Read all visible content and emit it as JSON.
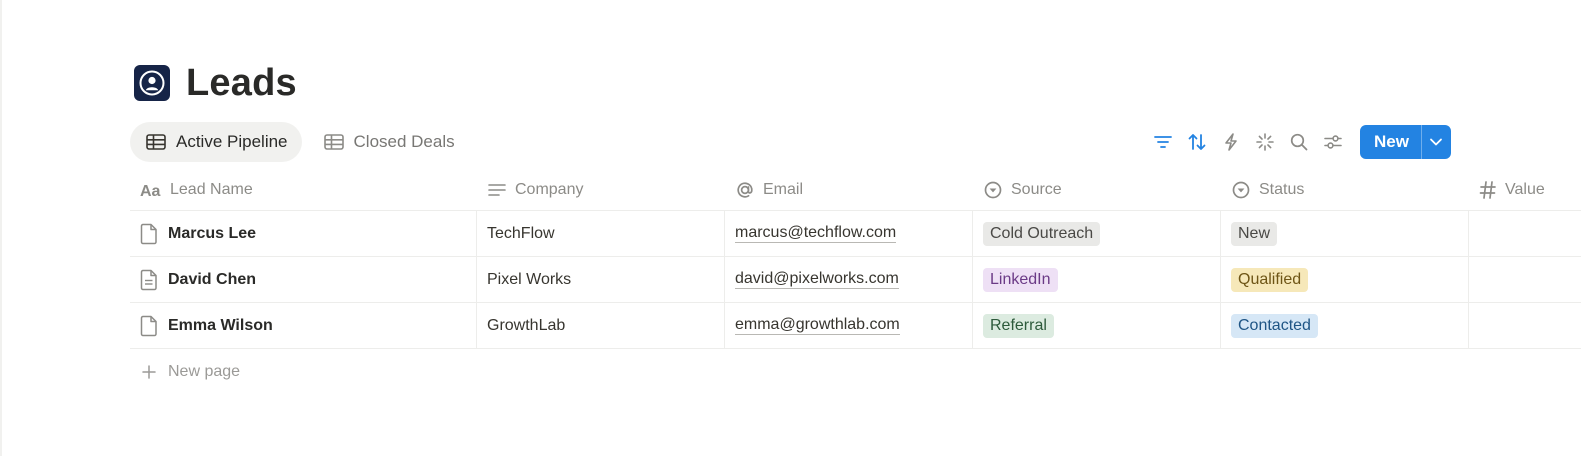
{
  "page": {
    "title": "Leads"
  },
  "views": [
    {
      "label": "Active Pipeline",
      "active": true
    },
    {
      "label": "Closed Deals",
      "active": false
    }
  ],
  "toolbar": {
    "new_label": "New",
    "accent": "#2383e2"
  },
  "table": {
    "columns": [
      {
        "label": "Lead Name",
        "icon": "title-aa-icon"
      },
      {
        "label": "Company",
        "icon": "text-lines-icon"
      },
      {
        "label": "Email",
        "icon": "at-sign-icon"
      },
      {
        "label": "Source",
        "icon": "select-circle-icon"
      },
      {
        "label": "Status",
        "icon": "select-circle-icon"
      },
      {
        "label": "Value",
        "icon": "number-hash-icon"
      }
    ],
    "rows": [
      {
        "name": "Marcus Lee",
        "company": "TechFlow",
        "email": "marcus@techflow.com",
        "source": {
          "label": "Cold Outreach",
          "bg": "#e9e9e7",
          "fg": "#4a4946"
        },
        "status": {
          "label": "New",
          "bg": "#e9e9e7",
          "fg": "#4a4946"
        },
        "value": ""
      },
      {
        "name": "David Chen",
        "company": "Pixel Works",
        "email": "david@pixelworks.com",
        "source": {
          "label": "LinkedIn",
          "bg": "#eee0f5",
          "fg": "#6b3a86"
        },
        "status": {
          "label": "Qualified",
          "bg": "#f6e8b9",
          "fg": "#6e5516"
        },
        "value": ""
      },
      {
        "name": "Emma Wilson",
        "company": "GrowthLab",
        "email": "emma@growthlab.com",
        "source": {
          "label": "Referral",
          "bg": "#dcebe0",
          "fg": "#2d5a3b"
        },
        "status": {
          "label": "Contacted",
          "bg": "#d6e7f6",
          "fg": "#1f5585"
        },
        "value": ""
      }
    ],
    "new_page_label": "New page"
  }
}
